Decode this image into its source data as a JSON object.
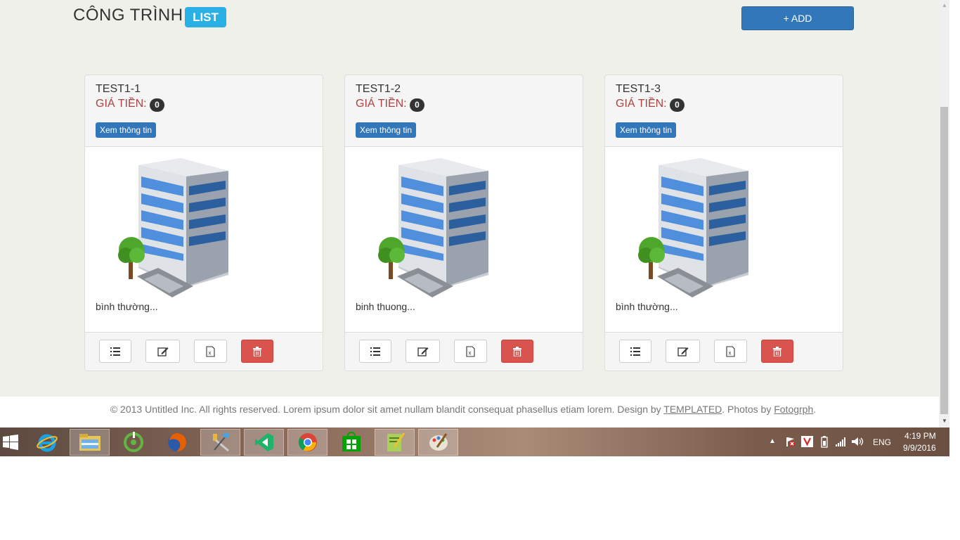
{
  "header": {
    "title": "CÔNG TRÌNH",
    "badge": "LIST",
    "add_button": "+ ADD"
  },
  "cards": [
    {
      "title": "TEST1-1",
      "price_label": "GIÁ TIỀN:",
      "price": "0",
      "view_button": "Xem thông tin",
      "description": "bình thường..."
    },
    {
      "title": "TEST1-2",
      "price_label": "GIÁ TIỀN:",
      "price": "0",
      "view_button": "Xem thông tin",
      "description": "binh thuong..."
    },
    {
      "title": "TEST1-3",
      "price_label": "GIÁ TIỀN:",
      "price": "0",
      "view_button": "Xem thông tin",
      "description": "bình thường..."
    }
  ],
  "card_actions": [
    "list-icon",
    "edit-icon",
    "excel-icon",
    "trash-icon"
  ],
  "footer": {
    "prefix": "© 2013 Untitled Inc. All rights reserved. Lorem ipsum dolor sit amet nullam blandit consequat phasellus etiam lorem. Design by ",
    "design_link": "TEMPLATED",
    "middle": ". Photos by ",
    "photos_link": "Fotogrph",
    "suffix": "."
  },
  "taskbar": {
    "apps": [
      "internet-explorer-icon",
      "file-explorer-icon",
      "greenshot-icon",
      "firefox-icon",
      "tools-icon",
      "visual-studio-icon",
      "chrome-icon",
      "store-icon",
      "notepad-icon",
      "paint-icon"
    ],
    "active_app": "chrome-icon",
    "language": "ENG",
    "time": "4:19 PM",
    "date": "9/9/2016"
  },
  "colors": {
    "primary": "#3377bb",
    "info": "#2ab0e4",
    "danger": "#d9534f",
    "price_text": "#a94442",
    "page_bg": "#f0f0ea"
  }
}
